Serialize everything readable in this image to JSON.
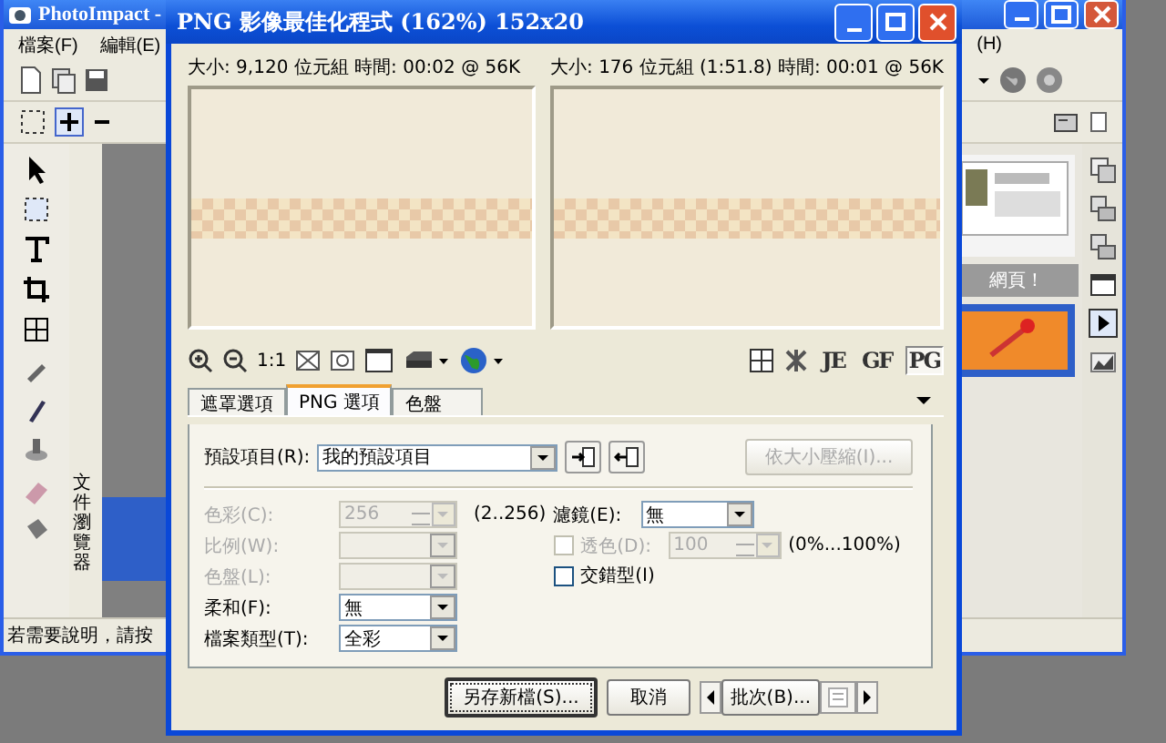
{
  "app": {
    "title": "PhotoImpact -",
    "menu_left": [
      "檔案(F)",
      "編輯(E)"
    ],
    "menu_right": [
      "(H)"
    ],
    "panel_title": "文件瀏覽器",
    "thumbnail_caption": "網頁！",
    "status": "若需要說明，請按"
  },
  "dialog": {
    "title": "PNG 影像最佳化程式 (162%) 152x20",
    "previews": [
      {
        "info": "大小: 9,120 位元組 時間: 00:02 @ 56K"
      },
      {
        "info": "大小: 176 位元組 (1:51.8) 時間: 00:01 @ 56K"
      }
    ],
    "zoom_label": "1:1",
    "format_buttons": [
      {
        "label": "JE",
        "selected": false
      },
      {
        "label": "GF",
        "selected": false
      },
      {
        "label": "PG",
        "selected": true
      }
    ],
    "tabs": [
      {
        "label": "遮罩選項",
        "selected": false
      },
      {
        "label": "PNG 選項",
        "selected": true
      },
      {
        "label": "色盤",
        "selected": false
      }
    ],
    "preset": {
      "label": "預設項目(R):",
      "value": "我的預設項目"
    },
    "compress_button": {
      "label": "依大小壓縮(I)...",
      "disabled": true
    },
    "fields": [
      {
        "kind": "spin",
        "label": "色彩(C):",
        "value": "256",
        "hint": "(2..256)",
        "disabled": true
      },
      {
        "kind": "select",
        "label": "比例(W):",
        "disabled": true
      },
      {
        "kind": "select",
        "label": "色盤(L):",
        "disabled": true
      },
      {
        "kind": "select",
        "label": "柔和(F):",
        "value": "無",
        "disabled": false
      },
      {
        "kind": "select",
        "label": "檔案類型(T):",
        "value": "全彩",
        "disabled": false
      }
    ],
    "right_fields": [
      {
        "kind": "select",
        "label": "濾鏡(E):",
        "value": "無",
        "disabled": false
      },
      {
        "kind": "check-spin",
        "label": "透色(D):",
        "checked": false,
        "value": "100",
        "hint": "(0%...100%)",
        "disabled": true
      },
      {
        "kind": "check",
        "label": "交錯型(I)",
        "checked": false,
        "disabled": false
      }
    ],
    "buttons": [
      {
        "kind": "default",
        "label": "另存新檔(S)..."
      },
      {
        "kind": "plain",
        "label": "取消"
      },
      {
        "kind": "batch",
        "label": "批次(B)..."
      }
    ]
  }
}
